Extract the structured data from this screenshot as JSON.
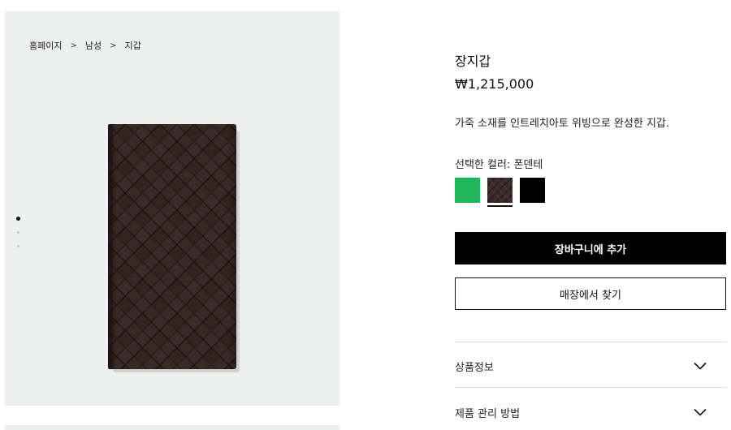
{
  "breadcrumb": {
    "items": [
      "홈페이지",
      "남성",
      "지갑"
    ],
    "separator": ">"
  },
  "gallery": {
    "image_count": 3,
    "active_index": 0,
    "background": "#eef0ef",
    "product_color": "#2e2120"
  },
  "product": {
    "title": "장지갑",
    "price": "₩1,215,000",
    "description": "가죽 소재를 인트레치아토 위빙으로 완성한 지갑."
  },
  "color_selector": {
    "label": "선택한 컬러: 폰덴테",
    "swatches": [
      {
        "name": "green",
        "color": "#1eb85a",
        "selected": false
      },
      {
        "name": "fondant",
        "color": "#3a2c2a",
        "selected": true
      },
      {
        "name": "black",
        "color": "#000000",
        "selected": false
      }
    ]
  },
  "actions": {
    "add_to_cart": "장바구니에 추가",
    "find_in_store": "매장에서 찾기"
  },
  "accordion": {
    "items": [
      "상품정보",
      "제품 관리 방법"
    ]
  }
}
